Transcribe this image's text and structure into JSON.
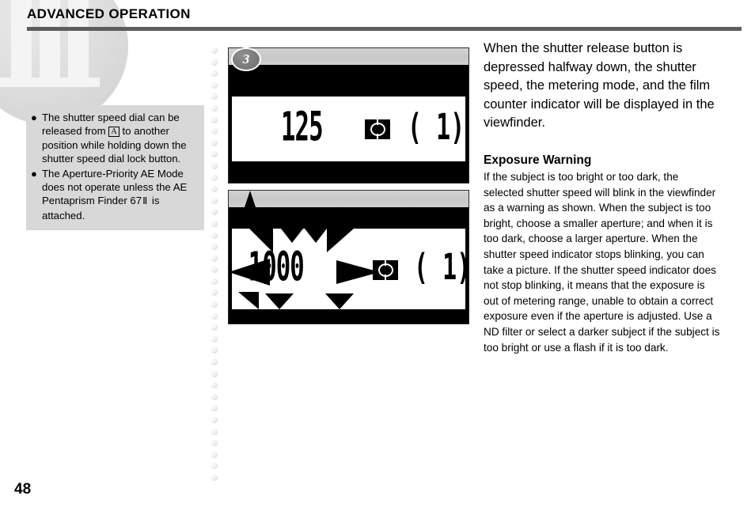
{
  "header": {
    "title": "ADVANCED OPERATION"
  },
  "watermark": {
    "chapter_numeral": "III"
  },
  "note_box": {
    "items": [
      {
        "bullet": "●",
        "text_before": "The shutter speed dial can be released from ",
        "boxed_symbol": "A",
        "text_after": " to another position while holding down the shutter speed dial lock button."
      },
      {
        "bullet": "●",
        "text_before": "The Aperture-Priority AE Mode does not operate unless the AE Pentaprism Finder 67",
        "boxed_symbol": "Ⅱ",
        "text_after": " is attached."
      }
    ]
  },
  "figures": {
    "step_badge": "3",
    "normal": {
      "caption_role": "viewfinder-normal-display",
      "shutter_speed": "125",
      "metering_icon": "center-weighted-metering-icon",
      "film_counter": "( 1)"
    },
    "warning": {
      "caption_role": "viewfinder-warning-display",
      "shutter_speed": "1000",
      "metering_icon": "center-weighted-metering-icon",
      "film_counter": "( 1)",
      "effect": "blinking-starburst"
    }
  },
  "right_column": {
    "intro": "When the shutter release button is depressed halfway down, the shutter speed, the metering mode, and the film counter indicator will be displayed in the viewfinder.",
    "exposure_heading": "Exposure Warning",
    "exposure_body": "If the subject is too bright or too dark, the selected shutter speed will blink in the viewfinder as a warning as shown. When the subject is too bright, choose a smaller aperture; and when it is too dark, choose a larger aperture. When the shutter speed indicator stops blinking, you can take a picture. If the shutter speed indicator does not stop blinking, it means that the exposure is out of metering range, unable to obtain a correct exposure even if the aperture is adjusted. Use a ND filter or select a darker subject if the subject is too bright or use a flash if it is too dark."
  },
  "footer": {
    "page_number": "48"
  },
  "colors": {
    "rule": "#5d5d5d",
    "note_box_bg": "#d8d8d8",
    "figure_frame": "#000000",
    "badge": "#7a7a7a"
  }
}
